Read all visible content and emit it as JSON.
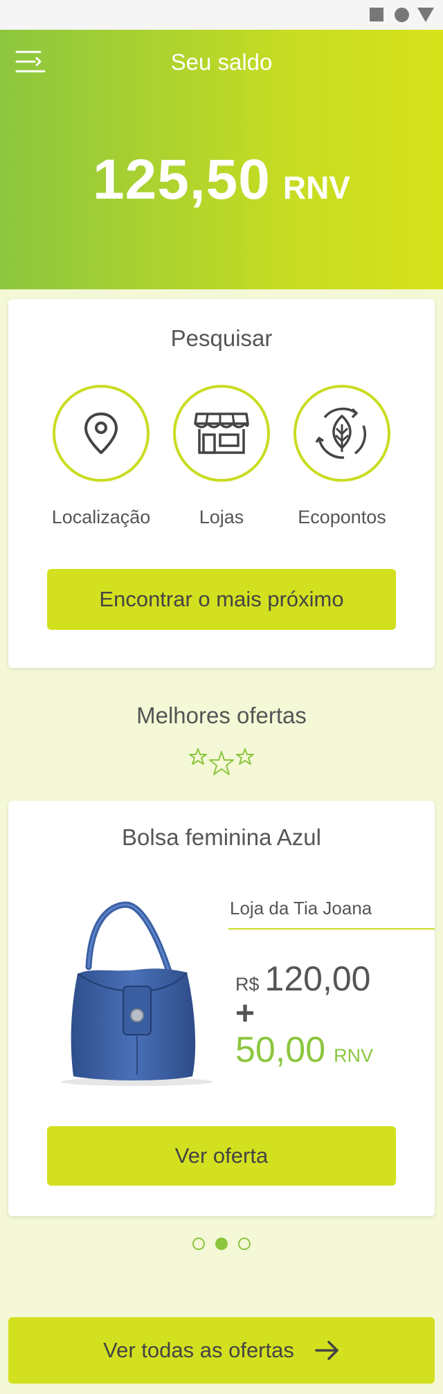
{
  "status_bar": {
    "icons": [
      "square-icon",
      "circle-icon",
      "triangle-icon"
    ]
  },
  "header": {
    "title": "Seu saldo",
    "balance_value": "125,50",
    "balance_unit": "RNV"
  },
  "search": {
    "title": "Pesquisar",
    "options": [
      {
        "label": "Localização",
        "icon": "location-pin-icon"
      },
      {
        "label": "Lojas",
        "icon": "store-icon"
      },
      {
        "label": "Ecopontos",
        "icon": "recycle-leaf-icon"
      }
    ],
    "button_label": "Encontrar o mais próximo"
  },
  "offers": {
    "section_title": "Melhores ofertas",
    "current": {
      "title": "Bolsa feminina Azul",
      "store": "Loja da Tia Joana",
      "currency": "R$",
      "price": "120,00",
      "plus": "+",
      "rnv_value": "50,00",
      "rnv_unit": "RNV",
      "button_label": "Ver oferta"
    },
    "pagination": {
      "total": 3,
      "active": 2
    },
    "all_button_label": "Ver todas as ofertas"
  },
  "colors": {
    "accent_lime": "#d3e01f",
    "accent_green": "#8cc63f",
    "background": "#f4f8d6",
    "text": "#555555"
  }
}
